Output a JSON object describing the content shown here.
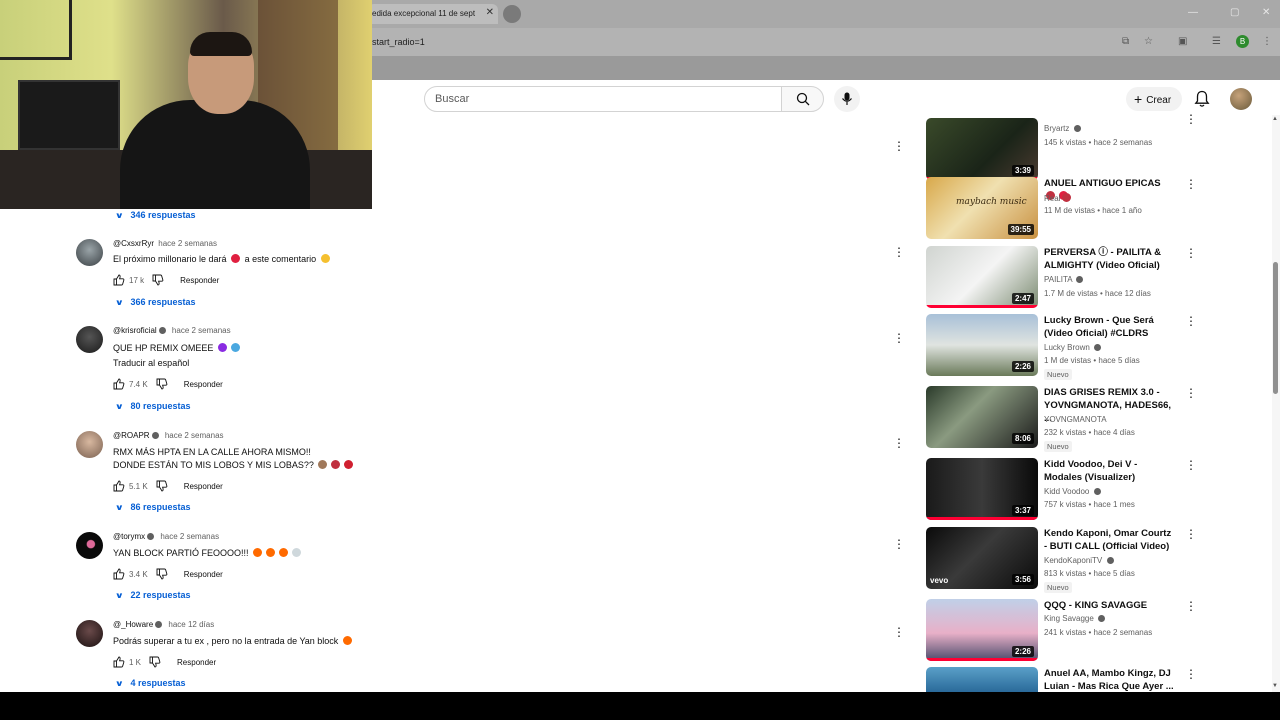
{
  "browser": {
    "tab_title": "edida excepcional 11 de sept",
    "address": "start_radio=1",
    "profile_letter": "B"
  },
  "header": {
    "search_placeholder": "Buscar",
    "create_label": "Crear"
  },
  "top_replies": "346 respuestas",
  "comments": [
    {
      "user": "@CxsxrRyr",
      "verified": false,
      "time": "hace 2 semanas",
      "text": "El próximo millonario le dará",
      "text_after": "a este comentario",
      "likes": "17 k",
      "reply": "Responder",
      "replies": "366 respuestas"
    },
    {
      "user": "@krisroficial",
      "verified": true,
      "time": "hace 2 semanas",
      "text": "QUE HP REMIX OMEEE",
      "translate": "Traducir al español",
      "likes": "7.4 K",
      "reply": "Responder",
      "replies": "80 respuestas"
    },
    {
      "user": "@ROAPR",
      "verified": true,
      "time": "hace 2 semanas",
      "text": "RMX MÁS HPTA EN LA CALLE AHORA MISMO!!",
      "text2": "DONDE ESTÁN TO MIS LOBOS Y MIS LOBAS??",
      "likes": "5.1 K",
      "reply": "Responder",
      "replies": "86 respuestas"
    },
    {
      "user": "@torymx",
      "verified": true,
      "time": "hace 2 semanas",
      "text": "YAN BLOCK PARTIÓ FEOOOO!!!",
      "likes": "3.4 K",
      "reply": "Responder",
      "replies": "22 respuestas"
    },
    {
      "user": "@_Howare",
      "verified": true,
      "time": "hace 12 días",
      "text": "Podrás superar a tu ex , pero no la entrada de Yan block",
      "likes": "1 K",
      "reply": "Responder",
      "replies": "4 respuestas"
    }
  ],
  "videos": [
    {
      "title": "",
      "channel": "Bryartz",
      "verified": true,
      "meta": "145 k vistas • hace 2 semanas",
      "duration": "3:39",
      "badge": ""
    },
    {
      "title": "ANUEL ANTIGUO EPICAS",
      "channel": "Real",
      "verified": false,
      "meta": "11 M de vistas • hace 1 año",
      "duration": "39:55",
      "badge": "",
      "thumb_text": "maybach music"
    },
    {
      "title": "PERVERSA ⓘ - PAILITA & ALMIGHTY (Video Oficial)",
      "channel": "PAILITA",
      "verified": true,
      "meta": "1.7 M de vistas • hace 12 días",
      "duration": "2:47",
      "badge": ""
    },
    {
      "title": "Lucky Brown - Que Será (Video Oficial) #CLDRS",
      "channel": "Lucky Brown",
      "verified": true,
      "meta": "1 M de vistas • hace 5 días",
      "duration": "2:26",
      "badge": "Nuevo"
    },
    {
      "title": "DIAS GRISES REMIX 3.0 - YOVNGMANOTA, HADES66, ...",
      "channel": "YOVNGMANOTA",
      "verified": false,
      "meta": "232 k vistas • hace 4 días",
      "duration": "8:06",
      "badge": "Nuevo"
    },
    {
      "title": "Kidd Voodoo, Dei V - Modales (Visualizer)",
      "channel": "Kidd Voodoo",
      "verified": true,
      "meta": "757 k vistas • hace 1 mes",
      "duration": "3:37",
      "badge": ""
    },
    {
      "title": "Kendo Kaponi, Omar Courtz - BUTI CALL (Official Video)",
      "channel": "KendoKaponiTV",
      "verified": true,
      "meta": "813 k vistas • hace 5 días",
      "duration": "3:56",
      "badge": "Nuevo",
      "thumb_text": "vevo"
    },
    {
      "title": "QQQ - KING SAVAGGE",
      "channel": "King Savagge",
      "verified": true,
      "meta": "241 k vistas • hace 2 semanas",
      "duration": "2:26",
      "badge": ""
    },
    {
      "title": "Anuel AA, Mambo Kingz, DJ Luian - Mas Rica Que Ayer ...",
      "channel": "",
      "verified": false,
      "meta": "",
      "duration": "",
      "badge": ""
    }
  ]
}
